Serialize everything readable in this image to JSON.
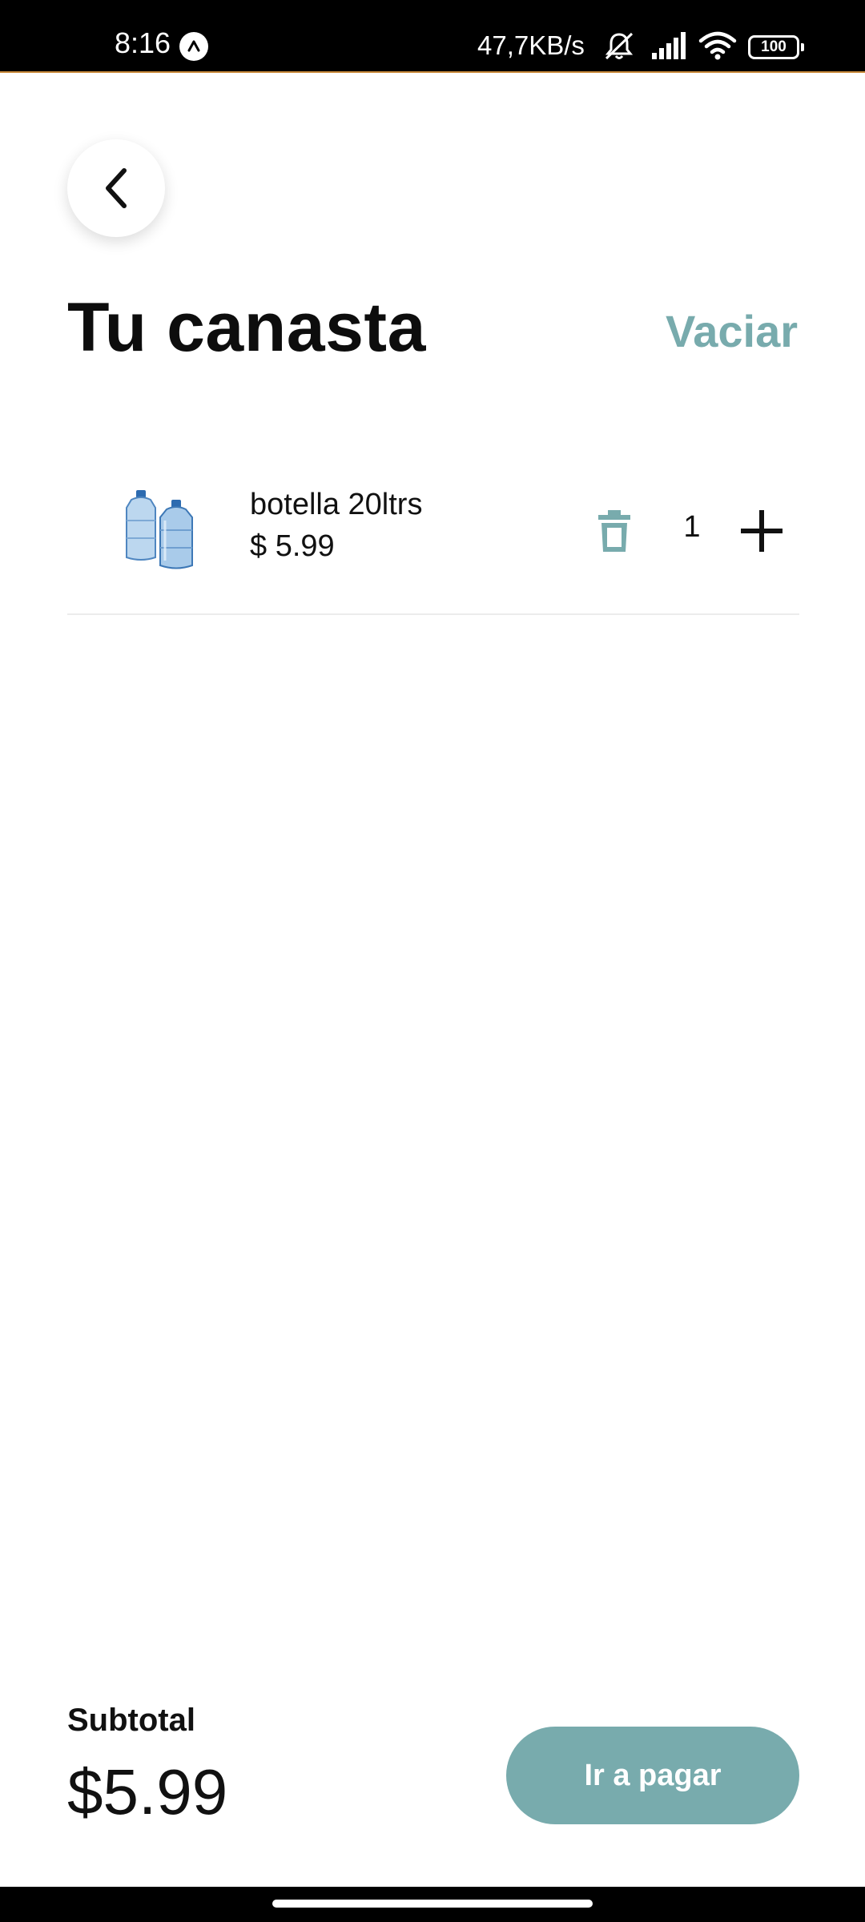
{
  "status_bar": {
    "time": "8:16",
    "network_speed": "47,7KB/s",
    "battery_level": "100",
    "icons": [
      "app-notification-icon",
      "mute-icon",
      "signal-icon",
      "wifi-icon",
      "battery-icon"
    ]
  },
  "header": {
    "title": "Tu canasta",
    "clear_label": "Vaciar"
  },
  "cart": {
    "items": [
      {
        "name": "botella 20ltrs",
        "price": "$ 5.99",
        "quantity": "1"
      }
    ]
  },
  "footer": {
    "subtotal_label": "Subtotal",
    "subtotal_value": "$5.99",
    "checkout_label": "Ir a pagar"
  },
  "colors": {
    "accent": "#78abad",
    "text": "#111111",
    "background": "#ffffff"
  }
}
